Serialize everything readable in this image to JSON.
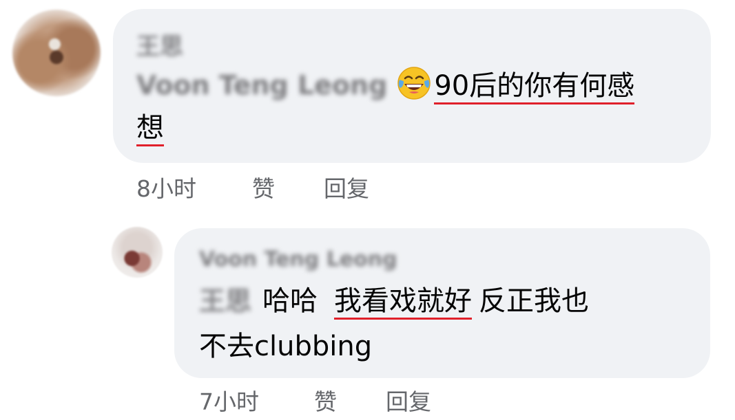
{
  "comments": [
    {
      "author": "王思",
      "mention": "Voon Teng Leong",
      "emoji": "tears-of-joy-emoji",
      "text_line1": "90后的你有何感",
      "text_line2": "想",
      "time": "8小时",
      "like_label": "赞",
      "reply_label": "回复"
    }
  ],
  "replies": [
    {
      "author": "Voon Teng Leong",
      "mention": "王思",
      "text_a": "哈哈",
      "text_b": "我看戏就好",
      "text_c": "反正我也",
      "text_line2": "不去clubbing",
      "time": "7小时",
      "like_label": "赞",
      "reply_label": "回复"
    }
  ],
  "colors": {
    "bubble": "#f0f2f5",
    "meta_text": "#65676b",
    "underline": "#e0202a"
  }
}
